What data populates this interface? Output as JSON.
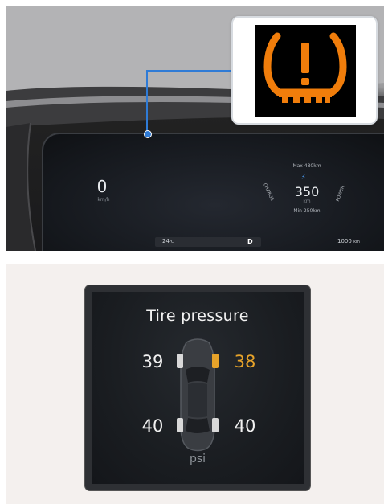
{
  "cluster": {
    "speed": {
      "value": "0",
      "unit": "km/h"
    },
    "range": {
      "max_label": "Max 480km",
      "value": "350",
      "unit": "km",
      "min_label": "Min 250km",
      "left_arc_label": "CHARGE",
      "right_arc_label": "POWER"
    },
    "footer": {
      "temperature": "24",
      "temperature_unit": "℃",
      "gear": "D",
      "odometer": "1000",
      "odometer_unit": "km"
    }
  },
  "warning_indicator": {
    "icon": "tire-pressure-warning-icon",
    "color": "#f07d0b"
  },
  "tire_pressure": {
    "title": "Tire pressure",
    "unit": "psi",
    "front_left": "39",
    "front_right": "38",
    "rear_left": "40",
    "rear_right": "40",
    "warning_tire": "front_right",
    "warning_color": "#e7a32a"
  }
}
